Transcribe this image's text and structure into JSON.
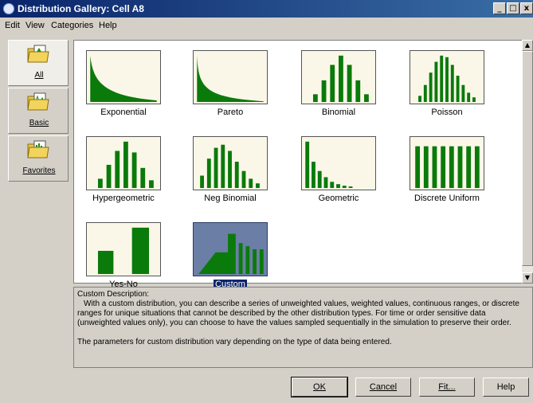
{
  "window": {
    "title": "Distribution Gallery: Cell A8",
    "minimize": "_",
    "maximize": "□",
    "close": "x"
  },
  "menu": [
    "Edit",
    "View",
    "Categories",
    "Help"
  ],
  "categories": [
    {
      "label": "All",
      "selected": true
    },
    {
      "label": "Basic",
      "selected": false
    },
    {
      "label": "Favorites",
      "selected": false
    }
  ],
  "distributions": [
    {
      "label": "Exponential",
      "icon": "exponential-curve"
    },
    {
      "label": "Pareto",
      "icon": "pareto-curve"
    },
    {
      "label": "Binomial",
      "icon": "binomial-bars"
    },
    {
      "label": "Poisson",
      "icon": "poisson-bars"
    },
    {
      "label": "Hypergeometric",
      "icon": "hypergeometric-bars"
    },
    {
      "label": "Neg Binomial",
      "icon": "neg-binomial-bars"
    },
    {
      "label": "Geometric",
      "icon": "geometric-bars"
    },
    {
      "label": "Discrete Uniform",
      "icon": "uniform-bars"
    },
    {
      "label": "Yes-No",
      "icon": "yes-no-bars"
    },
    {
      "label": "Custom",
      "icon": "custom-shape",
      "selected": true
    }
  ],
  "description": {
    "heading": "Custom Description:",
    "para1": "With a custom distribution, you can describe a series of unweighted values, weighted values, continuous ranges, or discrete ranges for unique situations that cannot be described by the other distribution types. For time or order sensitive data (unweighted values only), you can choose to have the values sampled sequentially in the simulation to preserve their order.",
    "para2": "The parameters for custom distribution vary depending on the type of data being entered."
  },
  "buttons": {
    "ok": "OK",
    "cancel": "Cancel",
    "fit": "Fit...",
    "help": "Help"
  },
  "colors": {
    "bar_green": "#0a7a0a",
    "selection_blue": "#0a246a",
    "thumb_bg": "#fbf7e8"
  }
}
